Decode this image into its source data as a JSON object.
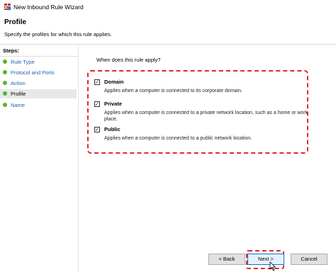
{
  "window": {
    "title": "New Inbound Rule Wizard",
    "icon": "firewall-rule-icon"
  },
  "header": {
    "title": "Profile",
    "subtitle": "Specify the profiles for which this rule applies."
  },
  "steps": {
    "heading": "Steps:",
    "items": [
      {
        "label": "Rule Type",
        "current": false
      },
      {
        "label": "Protocol and Ports",
        "current": false
      },
      {
        "label": "Action",
        "current": false
      },
      {
        "label": "Profile",
        "current": true
      },
      {
        "label": "Name",
        "current": false
      }
    ]
  },
  "main": {
    "question": "When does this rule apply?",
    "options": [
      {
        "label": "Domain",
        "checked": true,
        "description": "Applies when a computer is connected to its corporate domain."
      },
      {
        "label": "Private",
        "checked": true,
        "description": "Applies when a computer is connected to a private network location, such as a home or work place."
      },
      {
        "label": "Public",
        "checked": true,
        "description": "Applies when a computer is connected to a public network location."
      }
    ]
  },
  "buttons": {
    "back": "< Back",
    "next": "Next >",
    "cancel": "Cancel"
  },
  "colors": {
    "accent": "#0078d7",
    "highlight_dash": "#e12a2a",
    "step_dot": "#4fb82a",
    "link": "#1f5fb8"
  }
}
